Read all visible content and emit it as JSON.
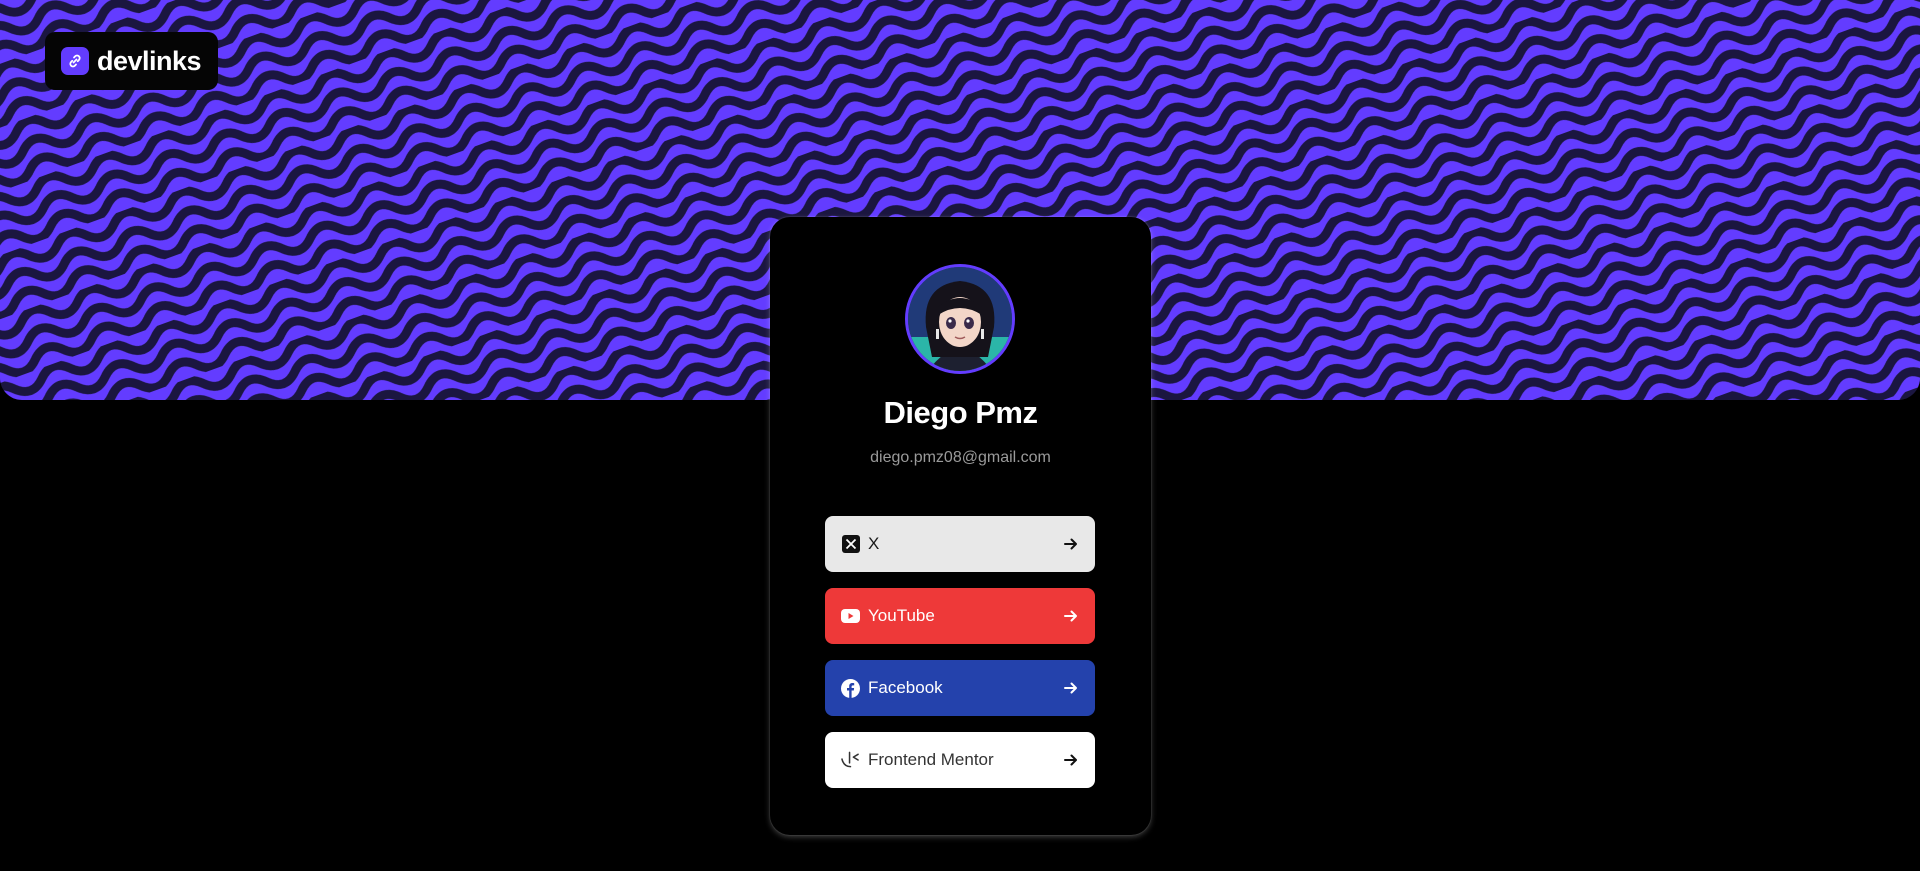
{
  "app": {
    "logo_text": "devlinks",
    "logo_icon": "link-icon",
    "accent": "#633cff"
  },
  "profile": {
    "name": "Diego Pmz",
    "email": "diego.pmz08@gmail.com",
    "avatar": "avatar-image"
  },
  "links": [
    {
      "label": "X",
      "icon": "x-icon",
      "bg": "#e8e8e8",
      "fg": "#1a1a1a"
    },
    {
      "label": "YouTube",
      "icon": "youtube-icon",
      "bg": "#ee3939",
      "fg": "#ffffff"
    },
    {
      "label": "Facebook",
      "icon": "facebook-icon",
      "bg": "#2442ac",
      "fg": "#ffffff"
    },
    {
      "label": "Frontend Mentor",
      "icon": "frontend-mentor-icon",
      "bg": "#ffffff",
      "fg": "#333333"
    }
  ]
}
